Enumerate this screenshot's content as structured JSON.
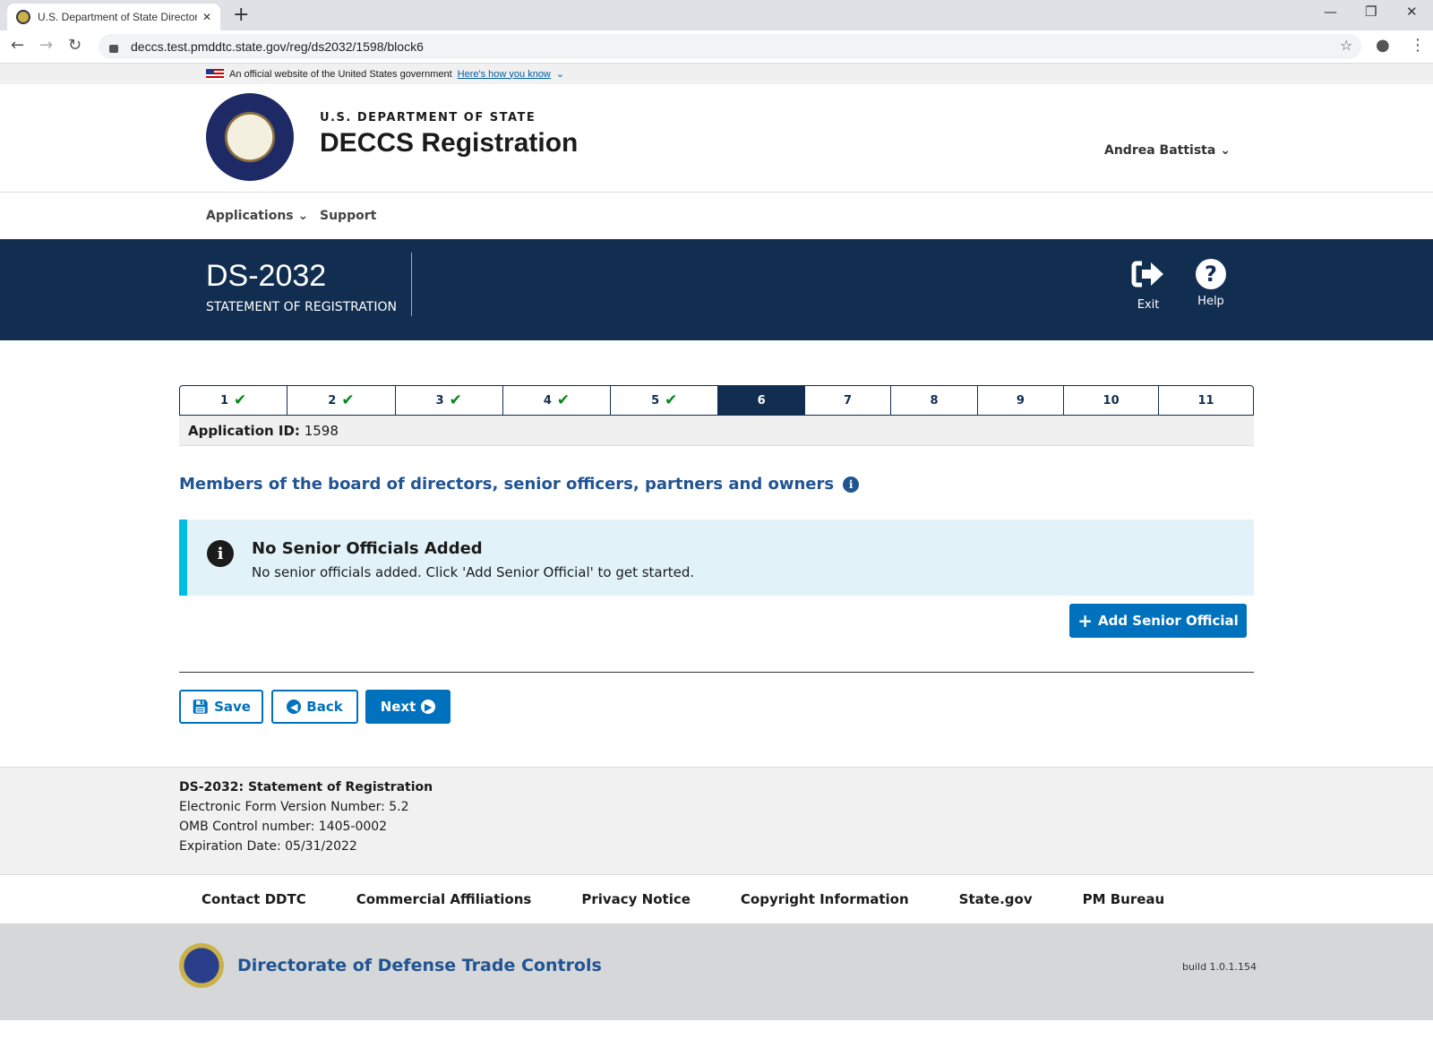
{
  "browser": {
    "tab_title": "U.S. Department of State Directorate of Defense Trade Controls",
    "url": "deccs.test.pmddtc.state.gov/reg/ds2032/1598/block6"
  },
  "gov_banner": {
    "text": "An official website of the United States government",
    "link": "Here's how you know"
  },
  "header": {
    "dept": "U.S. DEPARTMENT OF STATE",
    "title": "DECCS Registration",
    "user": "Andrea Battista"
  },
  "nav": {
    "applications": "Applications",
    "support": "Support"
  },
  "hero": {
    "form": "DS-2032",
    "subtitle": "STATEMENT OF REGISTRATION",
    "exit": "Exit",
    "help": "Help"
  },
  "steps": [
    {
      "label": "1",
      "done": true
    },
    {
      "label": "2",
      "done": true
    },
    {
      "label": "3",
      "done": true
    },
    {
      "label": "4",
      "done": true
    },
    {
      "label": "5",
      "done": true
    },
    {
      "label": "6",
      "current": true
    },
    {
      "label": "7"
    },
    {
      "label": "8"
    },
    {
      "label": "9"
    },
    {
      "label": "10"
    },
    {
      "label": "11"
    }
  ],
  "app": {
    "label": "Application ID:",
    "value": "1598"
  },
  "section": {
    "title": "Members of the board of directors, senior officers, partners and owners"
  },
  "alert": {
    "title": "No Senior Officials Added",
    "body": "No senior officials added. Click 'Add Senior Official' to get started."
  },
  "buttons": {
    "add": "Add Senior Official",
    "save": "Save",
    "back": "Back",
    "next": "Next"
  },
  "footer_info": {
    "title": "DS-2032: Statement of Registration",
    "version": "Electronic Form Version Number: 5.2",
    "omb": "OMB Control number: 1405-0002",
    "expiration": "Expiration Date: 05/31/2022"
  },
  "footer_links": [
    "Contact DDTC",
    "Commercial Affiliations",
    "Privacy Notice",
    "Copyright Information",
    "State.gov",
    "PM Bureau"
  ],
  "bottom": {
    "name": "Directorate of Defense Trade Controls",
    "build": "build 1.0.1.154"
  },
  "colors": {
    "navy": "#112e51",
    "primary": "#0071bc",
    "heading": "#205493",
    "check": "#008817",
    "alert_bg": "#e1f3f8",
    "alert_border": "#00bde3"
  }
}
